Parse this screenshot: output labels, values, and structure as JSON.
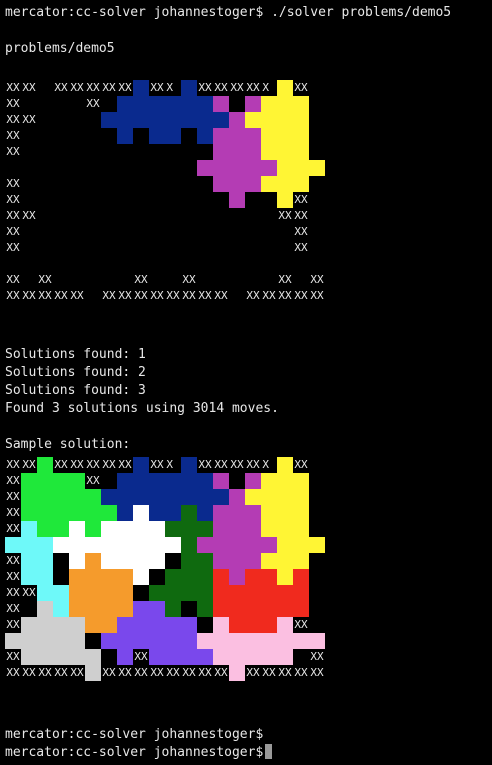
{
  "terminal": {
    "prompt_host": "mercator:cc-solver johannestoger$",
    "command": "./solver problems/demo5",
    "problem_name": "problems/demo5",
    "status_lines": [
      "Solutions found: 1",
      "Solutions found: 2",
      "Solutions found: 3",
      "Found 3 solutions using 3014 moves."
    ],
    "sample_label": "Sample solution:",
    "empty_prompts": [
      "mercator:cc-solver johannestoger$",
      "mercator:cc-solver johannestoger$"
    ]
  },
  "puzzle_rows": [
    "XXXX  XXXXXXXXXX XXXX  XXXXXXXXXX XXXX",
    "XX        XX                  XX    XX",
    "XXXX                              XXXX",
    "XX                                  XX",
    "XX                                  XX",
    "                                      ",
    "XX                                  XX",
    "XX                                  XX",
    "XXXX                              XXXX",
    "XX                                  XX",
    "XX                                  XX",
    "                                      ",
    "XX  XX          XX    XX          XX  XX",
    "XXXXXXXXXX  XXXXXXXXXXXXXXXX  XXXXXXXXXX"
  ],
  "colors": {
    "green": "#1fe83a",
    "navy": "#0a2a8e",
    "magenta": "#b43cb4",
    "yellow": "#fff534",
    "cyan": "#6ef9f9",
    "white": "#ffffff",
    "darkgreen": "#0f6a0f",
    "orange": "#f59b2c",
    "red": "#f02a1e",
    "gray": "#cfcfcf",
    "purple": "#7a48ec",
    "pink": "#fbbfe1"
  },
  "problem_pieces": [
    {
      "color": "navy",
      "cells": [
        [
          8,
          0
        ],
        [
          11,
          0
        ],
        [
          7,
          1
        ],
        [
          8,
          1
        ],
        [
          9,
          1
        ],
        [
          10,
          1
        ],
        [
          11,
          1
        ],
        [
          12,
          1
        ],
        [
          6,
          2
        ],
        [
          7,
          2
        ],
        [
          8,
          2
        ],
        [
          9,
          2
        ],
        [
          10,
          2
        ],
        [
          11,
          2
        ],
        [
          12,
          2
        ],
        [
          13,
          2
        ],
        [
          7,
          3
        ],
        [
          9,
          3
        ],
        [
          10,
          3
        ],
        [
          12,
          3
        ]
      ]
    },
    {
      "color": "magenta",
      "cells": [
        [
          13,
          1
        ],
        [
          15,
          1
        ],
        [
          14,
          2
        ],
        [
          13,
          3
        ],
        [
          14,
          3
        ],
        [
          15,
          3
        ],
        [
          13,
          4
        ],
        [
          14,
          4
        ],
        [
          15,
          4
        ],
        [
          12,
          5
        ],
        [
          13,
          5
        ],
        [
          14,
          5
        ],
        [
          15,
          5
        ],
        [
          16,
          5
        ],
        [
          13,
          6
        ],
        [
          14,
          6
        ],
        [
          15,
          6
        ],
        [
          14,
          7
        ]
      ]
    },
    {
      "color": "yellow",
      "cells": [
        [
          17,
          0
        ],
        [
          16,
          1
        ],
        [
          17,
          1
        ],
        [
          18,
          1
        ],
        [
          15,
          2
        ],
        [
          16,
          2
        ],
        [
          17,
          2
        ],
        [
          18,
          2
        ],
        [
          16,
          3
        ],
        [
          17,
          3
        ],
        [
          18,
          3
        ],
        [
          16,
          4
        ],
        [
          17,
          4
        ],
        [
          18,
          4
        ],
        [
          17,
          5
        ],
        [
          18,
          5
        ],
        [
          19,
          5
        ],
        [
          16,
          6
        ],
        [
          17,
          6
        ],
        [
          18,
          6
        ],
        [
          17,
          7
        ]
      ]
    }
  ],
  "solution_pieces": [
    {
      "color": "green",
      "cells": [
        [
          2,
          0
        ],
        [
          1,
          1
        ],
        [
          2,
          1
        ],
        [
          3,
          1
        ],
        [
          4,
          1
        ],
        [
          1,
          2
        ],
        [
          2,
          2
        ],
        [
          3,
          2
        ],
        [
          4,
          2
        ],
        [
          5,
          2
        ],
        [
          1,
          3
        ],
        [
          2,
          3
        ],
        [
          3,
          3
        ],
        [
          4,
          3
        ],
        [
          5,
          3
        ],
        [
          6,
          3
        ],
        [
          2,
          4
        ],
        [
          3,
          4
        ],
        [
          5,
          4
        ]
      ]
    },
    {
      "color": "navy",
      "cells": [
        [
          8,
          0
        ],
        [
          11,
          0
        ],
        [
          7,
          1
        ],
        [
          8,
          1
        ],
        [
          9,
          1
        ],
        [
          10,
          1
        ],
        [
          11,
          1
        ],
        [
          12,
          1
        ],
        [
          6,
          2
        ],
        [
          7,
          2
        ],
        [
          8,
          2
        ],
        [
          9,
          2
        ],
        [
          10,
          2
        ],
        [
          11,
          2
        ],
        [
          12,
          2
        ],
        [
          13,
          2
        ],
        [
          7,
          3
        ],
        [
          9,
          3
        ],
        [
          10,
          3
        ],
        [
          12,
          3
        ]
      ]
    },
    {
      "color": "magenta",
      "cells": [
        [
          13,
          1
        ],
        [
          15,
          1
        ],
        [
          14,
          2
        ],
        [
          13,
          3
        ],
        [
          14,
          3
        ],
        [
          15,
          3
        ],
        [
          13,
          4
        ],
        [
          14,
          4
        ],
        [
          15,
          4
        ],
        [
          12,
          5
        ],
        [
          13,
          5
        ],
        [
          14,
          5
        ],
        [
          15,
          5
        ],
        [
          16,
          5
        ],
        [
          13,
          6
        ],
        [
          14,
          6
        ],
        [
          15,
          6
        ],
        [
          14,
          7
        ]
      ]
    },
    {
      "color": "yellow",
      "cells": [
        [
          17,
          0
        ],
        [
          16,
          1
        ],
        [
          17,
          1
        ],
        [
          18,
          1
        ],
        [
          15,
          2
        ],
        [
          16,
          2
        ],
        [
          17,
          2
        ],
        [
          18,
          2
        ],
        [
          16,
          3
        ],
        [
          17,
          3
        ],
        [
          18,
          3
        ],
        [
          16,
          4
        ],
        [
          17,
          4
        ],
        [
          18,
          4
        ],
        [
          17,
          5
        ],
        [
          18,
          5
        ],
        [
          19,
          5
        ],
        [
          16,
          6
        ],
        [
          17,
          6
        ],
        [
          18,
          6
        ],
        [
          17,
          7
        ]
      ]
    },
    {
      "color": "cyan",
      "cells": [
        [
          1,
          4
        ],
        [
          0,
          5
        ],
        [
          1,
          5
        ],
        [
          2,
          5
        ],
        [
          1,
          6
        ],
        [
          2,
          6
        ],
        [
          1,
          7
        ],
        [
          2,
          7
        ],
        [
          2,
          8
        ],
        [
          3,
          8
        ],
        [
          3,
          9
        ]
      ]
    },
    {
      "color": "white",
      "cells": [
        [
          8,
          3
        ],
        [
          4,
          4
        ],
        [
          6,
          4
        ],
        [
          7,
          4
        ],
        [
          8,
          4
        ],
        [
          9,
          4
        ],
        [
          3,
          5
        ],
        [
          4,
          5
        ],
        [
          5,
          5
        ],
        [
          6,
          5
        ],
        [
          7,
          5
        ],
        [
          8,
          5
        ],
        [
          9,
          5
        ],
        [
          10,
          5
        ],
        [
          4,
          6
        ],
        [
          6,
          6
        ],
        [
          7,
          6
        ],
        [
          8,
          6
        ],
        [
          9,
          6
        ],
        [
          8,
          7
        ]
      ]
    },
    {
      "color": "darkgreen",
      "cells": [
        [
          11,
          3
        ],
        [
          10,
          4
        ],
        [
          11,
          4
        ],
        [
          12,
          4
        ],
        [
          11,
          5
        ],
        [
          11,
          6
        ],
        [
          12,
          6
        ],
        [
          10,
          7
        ],
        [
          11,
          7
        ],
        [
          12,
          7
        ],
        [
          9,
          8
        ],
        [
          10,
          8
        ],
        [
          11,
          8
        ],
        [
          12,
          8
        ],
        [
          10,
          9
        ],
        [
          12,
          9
        ]
      ]
    },
    {
      "color": "orange",
      "cells": [
        [
          5,
          6
        ],
        [
          4,
          7
        ],
        [
          5,
          7
        ],
        [
          6,
          7
        ],
        [
          7,
          7
        ],
        [
          4,
          8
        ],
        [
          5,
          8
        ],
        [
          6,
          8
        ],
        [
          7,
          8
        ],
        [
          4,
          9
        ],
        [
          5,
          9
        ],
        [
          6,
          9
        ],
        [
          7,
          9
        ],
        [
          8,
          9
        ],
        [
          5,
          10
        ],
        [
          6,
          10
        ],
        [
          7,
          10
        ]
      ]
    },
    {
      "color": "red",
      "cells": [
        [
          13,
          7
        ],
        [
          15,
          7
        ],
        [
          16,
          7
        ],
        [
          18,
          7
        ],
        [
          13,
          8
        ],
        [
          14,
          8
        ],
        [
          15,
          8
        ],
        [
          16,
          8
        ],
        [
          17,
          8
        ],
        [
          18,
          8
        ],
        [
          13,
          9
        ],
        [
          14,
          9
        ],
        [
          15,
          9
        ],
        [
          16,
          9
        ],
        [
          17,
          9
        ],
        [
          18,
          9
        ],
        [
          14,
          10
        ],
        [
          15,
          10
        ],
        [
          16,
          10
        ]
      ]
    },
    {
      "color": "gray",
      "cells": [
        [
          2,
          9
        ],
        [
          1,
          10
        ],
        [
          2,
          10
        ],
        [
          3,
          10
        ],
        [
          4,
          10
        ],
        [
          0,
          11
        ],
        [
          1,
          11
        ],
        [
          2,
          11
        ],
        [
          3,
          11
        ],
        [
          4,
          11
        ],
        [
          1,
          12
        ],
        [
          2,
          12
        ],
        [
          3,
          12
        ],
        [
          4,
          12
        ],
        [
          5,
          12
        ],
        [
          5,
          13
        ]
      ]
    },
    {
      "color": "purple",
      "cells": [
        [
          8,
          9
        ],
        [
          9,
          9
        ],
        [
          7,
          10
        ],
        [
          8,
          10
        ],
        [
          9,
          10
        ],
        [
          10,
          10
        ],
        [
          11,
          10
        ],
        [
          6,
          11
        ],
        [
          7,
          11
        ],
        [
          8,
          11
        ],
        [
          9,
          11
        ],
        [
          10,
          11
        ],
        [
          11,
          11
        ],
        [
          7,
          12
        ],
        [
          9,
          12
        ],
        [
          10,
          12
        ],
        [
          11,
          12
        ],
        [
          12,
          12
        ]
      ]
    },
    {
      "color": "pink",
      "cells": [
        [
          13,
          10
        ],
        [
          17,
          10
        ],
        [
          12,
          11
        ],
        [
          13,
          11
        ],
        [
          14,
          11
        ],
        [
          15,
          11
        ],
        [
          16,
          11
        ],
        [
          17,
          11
        ],
        [
          18,
          11
        ],
        [
          19,
          11
        ],
        [
          13,
          12
        ],
        [
          14,
          12
        ],
        [
          15,
          12
        ],
        [
          16,
          12
        ],
        [
          17,
          12
        ],
        [
          14,
          13
        ]
      ]
    }
  ]
}
